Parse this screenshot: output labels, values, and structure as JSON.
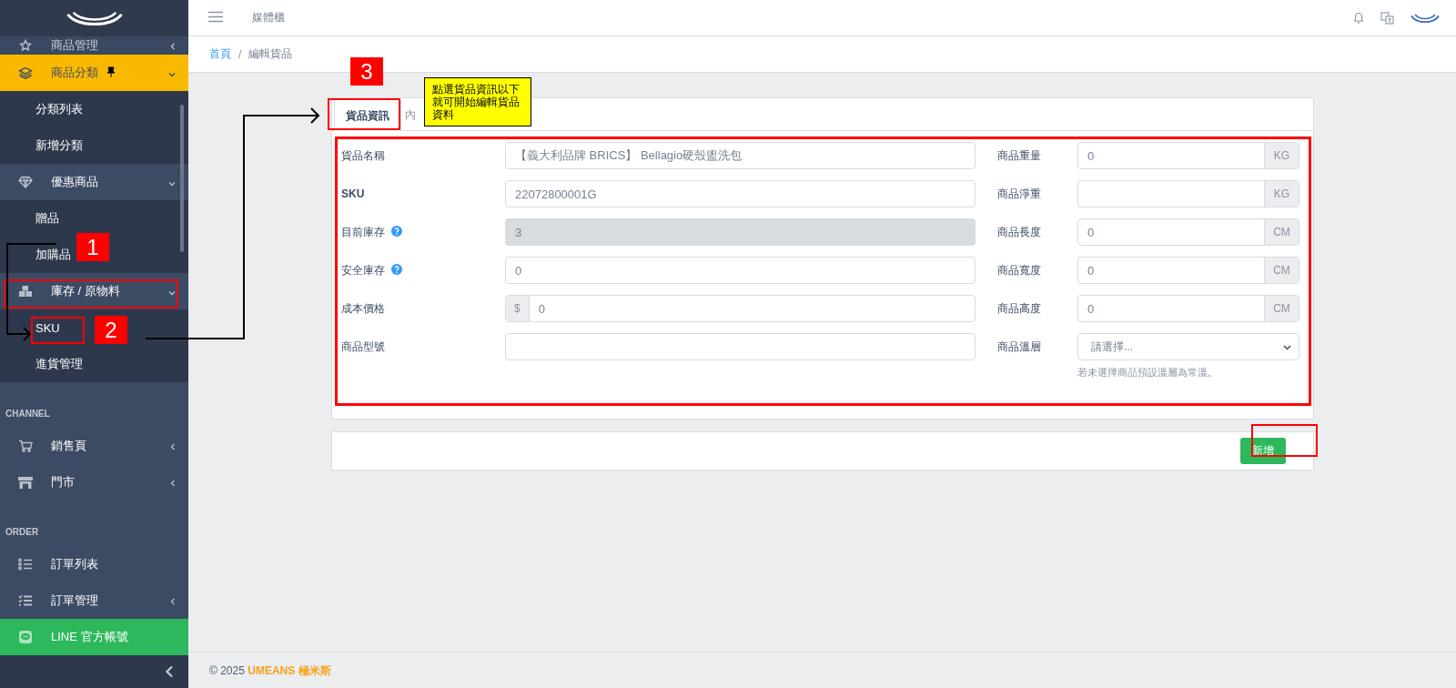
{
  "sidebar": {
    "menu": [
      {
        "kind": "group",
        "label": "商品管理",
        "expanded": false,
        "selected": false
      },
      {
        "kind": "group",
        "label": "商品分類",
        "expanded": true,
        "selected": true,
        "pinned": true,
        "children": [
          {
            "label": "分類列表"
          },
          {
            "label": "新增分類"
          }
        ]
      },
      {
        "kind": "group",
        "label": "優惠商品",
        "expanded": true,
        "selected": false,
        "children": [
          {
            "label": "贈品"
          },
          {
            "label": "加購品"
          }
        ]
      },
      {
        "kind": "group",
        "label": "庫存 / 原物料",
        "expanded": true,
        "selected": false,
        "children": [
          {
            "label": "SKU"
          },
          {
            "label": "進貨管理"
          }
        ]
      },
      {
        "kind": "header",
        "label": "CHANNEL"
      },
      {
        "kind": "group",
        "label": "銷售頁",
        "expanded": false,
        "selected": false
      },
      {
        "kind": "group",
        "label": "門市",
        "expanded": false,
        "selected": false
      },
      {
        "kind": "header",
        "label": "ORDER"
      },
      {
        "kind": "link",
        "label": "訂單列表"
      },
      {
        "kind": "group",
        "label": "訂單管理",
        "expanded": false,
        "selected": false
      },
      {
        "kind": "line",
        "label": "LINE 官方帳號"
      }
    ]
  },
  "topbar": {
    "title": "媒體櫃"
  },
  "breadcrumb": {
    "items": [
      {
        "label": "首頁",
        "link": true
      },
      {
        "label": "編輯貨品",
        "link": false
      }
    ],
    "separator": "/"
  },
  "tabs": [
    {
      "label": "貨品資訊",
      "selected": true
    },
    {
      "label": "內",
      "selected": false
    }
  ],
  "form": {
    "left": [
      {
        "label": "貨品名稱",
        "value": "【義大利品牌 BRICS】 Bellagio硬殼盥洗包"
      },
      {
        "label": "SKU",
        "value": "22072800001G",
        "strong": true
      },
      {
        "label": "目前庫存",
        "value": "3",
        "help": true,
        "disabled": true
      },
      {
        "label": "安全庫存",
        "value": "0",
        "help": true
      },
      {
        "label": "成本價格",
        "value": "0",
        "prefix": "$"
      },
      {
        "label": "商品型號"
      }
    ],
    "right": [
      {
        "label": "商品重量",
        "value": "0",
        "suffix": "KG"
      },
      {
        "label": "商品淨重",
        "suffix": "KG"
      },
      {
        "label": "商品長度",
        "value": "0",
        "suffix": "CM"
      },
      {
        "label": "商品寬度",
        "value": "0",
        "suffix": "CM"
      },
      {
        "label": "商品高度",
        "value": "0",
        "suffix": "CM"
      },
      {
        "label": "商品溫層",
        "kind": "select",
        "placeholder": "請選擇...",
        "hint": "若未選擇商品預設溫層為常溫。"
      }
    ]
  },
  "submit": {
    "label": "新增"
  },
  "footer": {
    "text": "© 2025 **UMEANS 極米斯**"
  },
  "annotations": {
    "badges": [
      "1",
      "2",
      "3"
    ],
    "callout": "點選貨品資訊以下就可開始編輯貨品資料"
  }
}
